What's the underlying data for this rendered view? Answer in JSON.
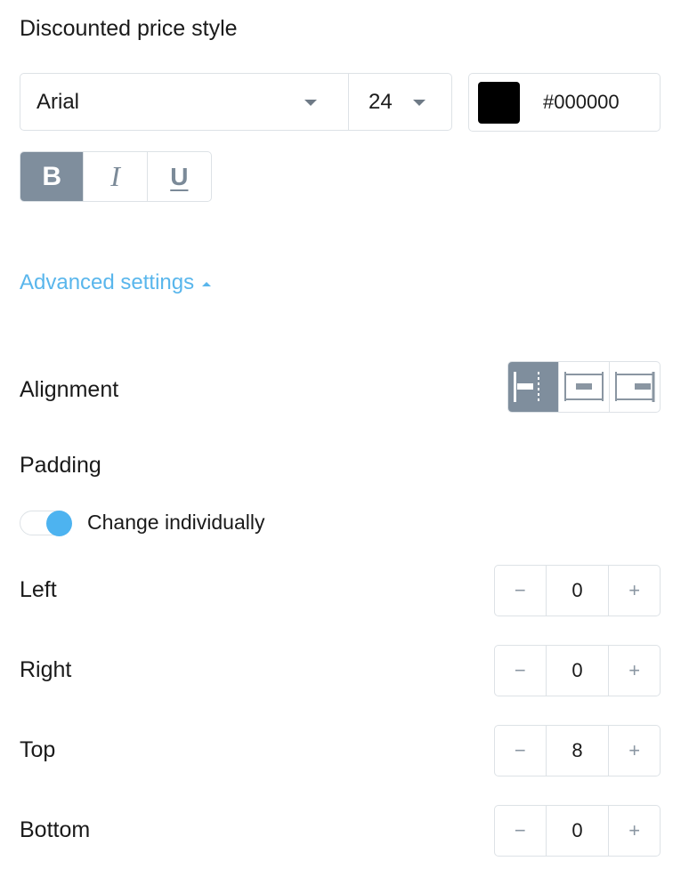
{
  "section_title": "Discounted price style",
  "font": {
    "family": "Arial",
    "size": "24",
    "color_hex": "#000000",
    "color_value": "#000000"
  },
  "text_style": {
    "bold_label": "B",
    "italic_label": "I",
    "underline_label": "U",
    "active": "bold"
  },
  "advanced_settings": "Advanced settings",
  "alignment": {
    "label": "Alignment",
    "options": [
      "align-left",
      "align-center",
      "align-right"
    ],
    "selected": "align-left"
  },
  "padding": {
    "label": "Padding",
    "toggle_label": "Change individually",
    "toggle_on": true,
    "rows": [
      {
        "label": "Left",
        "value": "0",
        "minus": "−",
        "plus": "+"
      },
      {
        "label": "Right",
        "value": "0",
        "minus": "−",
        "plus": "+"
      },
      {
        "label": "Top",
        "value": "8",
        "minus": "−",
        "plus": "+"
      },
      {
        "label": "Bottom",
        "value": "0",
        "minus": "−",
        "plus": "+"
      }
    ]
  },
  "colors": {
    "accent": "#59b6ec",
    "active_button": "#7f8e9d",
    "toggle_knob": "#4db3f0"
  }
}
